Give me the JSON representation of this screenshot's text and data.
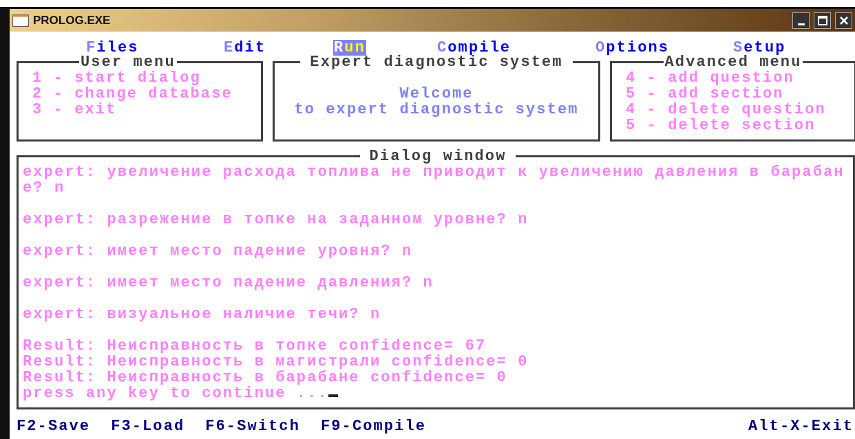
{
  "window": {
    "title": "PROLOG.EXE"
  },
  "menu": [
    {
      "label": "Files",
      "selected": false
    },
    {
      "label": "Edit",
      "selected": false
    },
    {
      "label": "Run",
      "selected": true
    },
    {
      "label": "Compile",
      "selected": false
    },
    {
      "label": "Options",
      "selected": false
    },
    {
      "label": "Setup",
      "selected": false
    }
  ],
  "user_menu": {
    "title": "User menu",
    "items": [
      "1 - start dialog",
      "2 - change database",
      "3 - exit"
    ]
  },
  "expert_panel": {
    "title": "Expert diagnostic system",
    "lines": [
      "Welcome",
      "to expert diagnostic system"
    ]
  },
  "advanced_menu": {
    "title": "Advanced menu",
    "items": [
      "4 - add question",
      "5 - add section",
      "4 - delete question",
      "5 - delete section"
    ]
  },
  "dialog": {
    "title": "Dialog window",
    "messages": [
      {
        "kind": "expert",
        "text": "expert: увеличение расхода топлива не приводит к увеличению давления в барабане? n"
      },
      {
        "kind": "expert",
        "text": "expert: разрежение в топке на заданном уровне? n"
      },
      {
        "kind": "expert",
        "text": "expert: имеет место падение уровня? n"
      },
      {
        "kind": "expert",
        "text": "expert: имеет место падение давления? n"
      },
      {
        "kind": "expert",
        "text": "expert: визуальное наличие течи? n"
      },
      {
        "kind": "result",
        "text": "Result: Неисправность в топке confidence= 67"
      },
      {
        "kind": "result",
        "text": "Result: Неисправность в магистрали confidence= 0"
      },
      {
        "kind": "result",
        "text": "Result: Неисправность в барабане confidence= 0"
      },
      {
        "kind": "prompt",
        "text": "press any key to continue ..."
      }
    ]
  },
  "status_bar": {
    "left": [
      "F2-Save",
      "F3-Load",
      "F6-Switch",
      "F9-Compile"
    ],
    "right": "Alt-X-Exit"
  }
}
